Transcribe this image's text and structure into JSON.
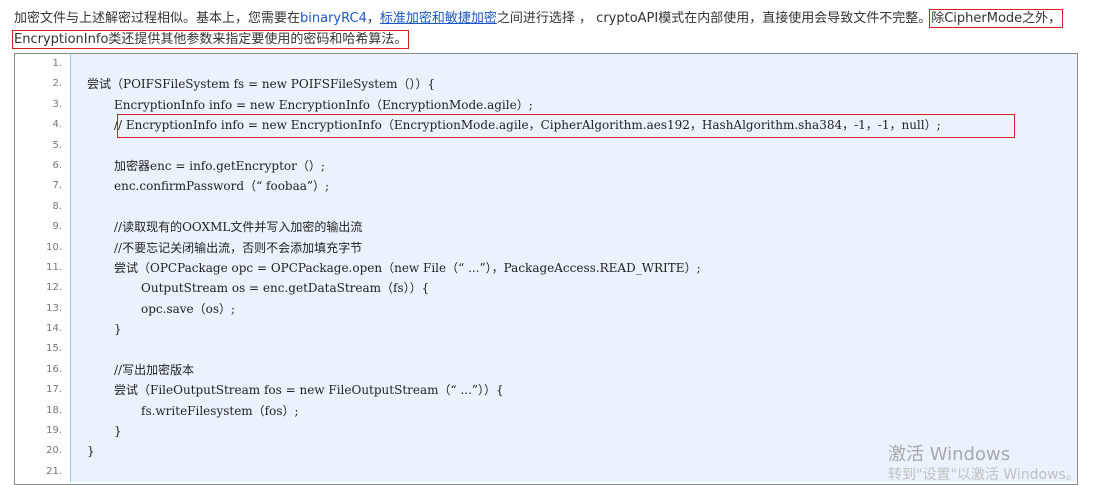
{
  "paragraph": {
    "part1": "加密文件与上述解密过程相似。基本上，您需要在",
    "link1": "binaryRC4",
    "sep": "，",
    "link2": "标准加密和敏捷加密",
    "part2": "之间进行选择 ，",
    "part3": "cryptoAPI模式在内部使用，直接使用会导致文件不完整。",
    "hl1": "除CipherMode之外，",
    "hl2": "EncryptionInfo类还提供其他参数来指定要使用的密码和哈希算法。"
  },
  "code_lines": [
    {
      "n": "1.",
      "text": "",
      "indent": 0
    },
    {
      "n": "2.",
      "text": "尝试（POIFSFileSystem fs = new POIFSFileSystem（））{",
      "indent": 0
    },
    {
      "n": "3.",
      "text": "EncryptionInfo info = new EncryptionInfo（EncryptionMode.agile）;",
      "indent": 1
    },
    {
      "n": "4.",
      "text": "// EncryptionInfo info = new EncryptionInfo（EncryptionMode.agile，CipherAlgorithm.aes192，HashAlgorithm.sha384，-1，-1，null）;",
      "indent": 1
    },
    {
      "n": "5.",
      "text": "",
      "indent": 0
    },
    {
      "n": "6.",
      "text": "加密器enc = info.getEncryptor（）;",
      "indent": 1
    },
    {
      "n": "7.",
      "text": "enc.confirmPassword（“ foobaa”）;",
      "indent": 1
    },
    {
      "n": "8.",
      "text": "",
      "indent": 0
    },
    {
      "n": "9.",
      "text": "//读取现有的OOXML文件并写入加密的输出流",
      "indent": 1
    },
    {
      "n": "10.",
      "text": "//不要忘记关闭输出流，否则不会添加填充字节",
      "indent": 1
    },
    {
      "n": "11.",
      "text": "尝试（OPCPackage opc = OPCPackage.open（new File（“ ...”），PackageAccess.READ_WRITE）;",
      "indent": 1
    },
    {
      "n": "12.",
      "text": "OutputStream os = enc.getDataStream（fs））{",
      "indent": 2
    },
    {
      "n": "13.",
      "text": "opc.save（os）;",
      "indent": 2
    },
    {
      "n": "14.",
      "text": "}",
      "indent": 1
    },
    {
      "n": "15.",
      "text": "",
      "indent": 0
    },
    {
      "n": "16.",
      "text": "//写出加密版本",
      "indent": 1
    },
    {
      "n": "17.",
      "text": "尝试（FileOutputStream fos = new FileOutputStream（“ ...”））{",
      "indent": 1
    },
    {
      "n": "18.",
      "text": "fs.writeFilesystem（fos）;",
      "indent": 2
    },
    {
      "n": "19.",
      "text": "}",
      "indent": 1
    },
    {
      "n": "20.",
      "text": "}",
      "indent": 0
    },
    {
      "n": "21.",
      "text": "",
      "indent": 0
    }
  ],
  "watermark": {
    "line1": "激活 Windows",
    "line2": "转到\"设置\"以激活 Windows。"
  }
}
